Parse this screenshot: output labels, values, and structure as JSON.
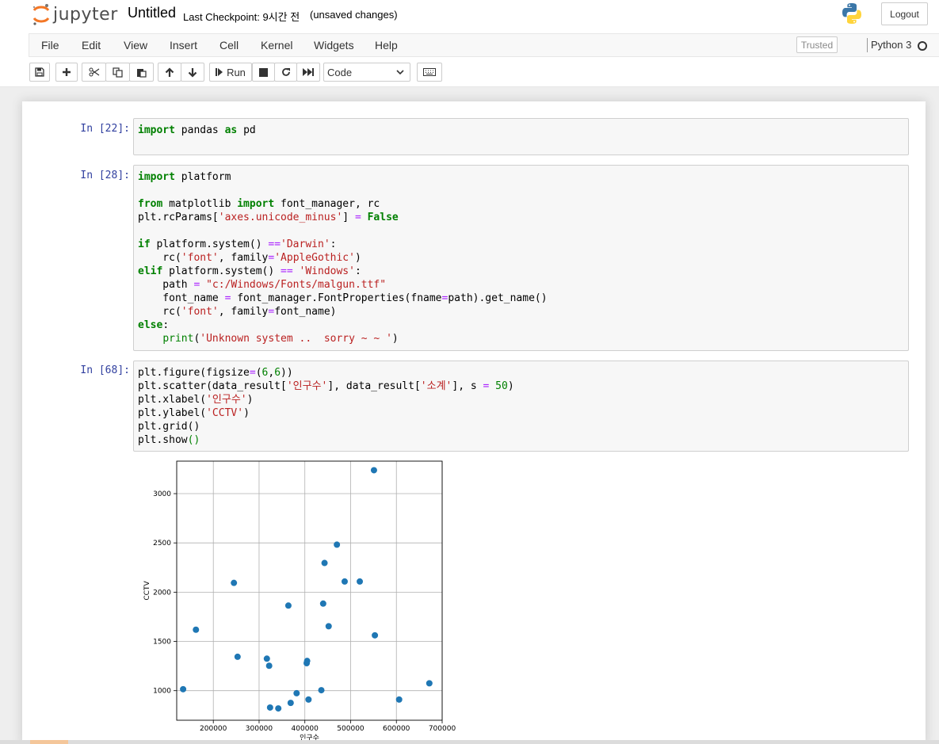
{
  "header": {
    "logo_text": "jupyter",
    "notebook_title": "Untitled",
    "checkpoint": "Last Checkpoint: 9시간 전",
    "unsaved": "(unsaved changes)",
    "logout_label": "Logout"
  },
  "menu": {
    "items": [
      "File",
      "Edit",
      "View",
      "Insert",
      "Cell",
      "Kernel",
      "Widgets",
      "Help"
    ],
    "trusted_label": "Trusted",
    "kernel_name": "Python 3"
  },
  "toolbar": {
    "run_label": "Run",
    "cell_type": "Code",
    "icons": [
      "save-icon",
      "plus-icon",
      "cut-icon",
      "copy-icon",
      "paste-icon",
      "arrow-up-icon",
      "arrow-down-icon",
      "step-forward-icon",
      "stop-icon",
      "refresh-icon",
      "fast-forward-icon",
      "keyboard-icon"
    ]
  },
  "cells": [
    {
      "prompt": "In [22]:",
      "lines": [
        "import pandas as pd"
      ]
    },
    {
      "prompt": "In [28]:",
      "lines": [
        "import platform",
        "",
        "from matplotlib import font_manager, rc",
        "plt.rcParams['axes.unicode_minus'] = False",
        "",
        "if platform.system() =='Darwin':",
        "    rc('font', family='AppleGothic')",
        "elif platform.system() == 'Windows':",
        "    path = \"c:/Windows/Fonts/malgun.ttf\"",
        "    font_name = font_manager.FontProperties(fname=path).get_name()",
        "    rc('font', family=font_name)",
        "else:",
        "    print('Unknown system ..  sorry ~ ~ ')"
      ]
    },
    {
      "prompt": "In [68]:",
      "lines": [
        "plt.figure(figsize=(6,6))",
        "plt.scatter(data_result['인구수'], data_result['소계'], s = 50)",
        "plt.xlabel('인구수')",
        "plt.ylabel('CCTV')",
        "plt.grid()",
        "plt.show()"
      ]
    }
  ],
  "chart_data": {
    "type": "scatter",
    "xlabel": "인구수",
    "ylabel": "CCTV",
    "grid": true,
    "xlim": [
      120000,
      700000
    ],
    "ylim": [
      700,
      3330
    ],
    "xticks": [
      200000,
      300000,
      400000,
      500000,
      600000,
      700000
    ],
    "yticks": [
      1000,
      1500,
      2000,
      2500,
      3000
    ],
    "marker_color": "#1f77b4",
    "points": [
      {
        "x": 134000,
        "y": 1015
      },
      {
        "x": 162000,
        "y": 1619
      },
      {
        "x": 245000,
        "y": 2094
      },
      {
        "x": 253000,
        "y": 1344
      },
      {
        "x": 317000,
        "y": 1325
      },
      {
        "x": 322000,
        "y": 1253
      },
      {
        "x": 324000,
        "y": 829
      },
      {
        "x": 342000,
        "y": 820
      },
      {
        "x": 364000,
        "y": 1864
      },
      {
        "x": 369000,
        "y": 876
      },
      {
        "x": 382000,
        "y": 974
      },
      {
        "x": 404000,
        "y": 1279
      },
      {
        "x": 405000,
        "y": 1302
      },
      {
        "x": 408000,
        "y": 910
      },
      {
        "x": 436000,
        "y": 1005
      },
      {
        "x": 440000,
        "y": 1884
      },
      {
        "x": 443000,
        "y": 2296
      },
      {
        "x": 452000,
        "y": 1654
      },
      {
        "x": 470000,
        "y": 2482
      },
      {
        "x": 487000,
        "y": 2108
      },
      {
        "x": 520000,
        "y": 2108
      },
      {
        "x": 551000,
        "y": 3238
      },
      {
        "x": 553000,
        "y": 1562
      },
      {
        "x": 606000,
        "y": 910
      },
      {
        "x": 672000,
        "y": 1075
      }
    ]
  }
}
